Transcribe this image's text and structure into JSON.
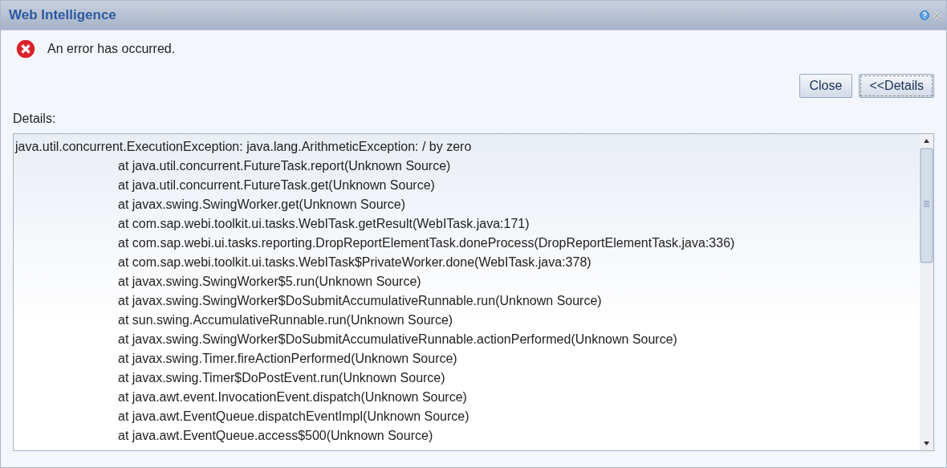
{
  "window": {
    "title": "Web Intelligence"
  },
  "message": "An error has occurred.",
  "buttons": [
    {
      "label": "Close",
      "focused": false
    },
    {
      "label": "<<Details",
      "focused": true
    }
  ],
  "details": {
    "label": "Details:",
    "lines": [
      {
        "kind": "exception",
        "text": "java.util.concurrent.ExecutionException: java.lang.ArithmeticException: / by zero"
      },
      {
        "kind": "frame",
        "text": "at java.util.concurrent.FutureTask.report(Unknown Source)"
      },
      {
        "kind": "frame",
        "text": "at java.util.concurrent.FutureTask.get(Unknown Source)"
      },
      {
        "kind": "frame",
        "text": "at javax.swing.SwingWorker.get(Unknown Source)"
      },
      {
        "kind": "frame",
        "text": "at com.sap.webi.toolkit.ui.tasks.WebITask.getResult(WebITask.java:171)"
      },
      {
        "kind": "frame",
        "text": "at com.sap.webi.ui.tasks.reporting.DropReportElementTask.doneProcess(DropReportElementTask.java:336)"
      },
      {
        "kind": "frame",
        "text": "at com.sap.webi.toolkit.ui.tasks.WebITask$PrivateWorker.done(WebITask.java:378)"
      },
      {
        "kind": "frame",
        "text": "at javax.swing.SwingWorker$5.run(Unknown Source)"
      },
      {
        "kind": "frame",
        "text": "at javax.swing.SwingWorker$DoSubmitAccumulativeRunnable.run(Unknown Source)"
      },
      {
        "kind": "frame",
        "text": "at sun.swing.AccumulativeRunnable.run(Unknown Source)"
      },
      {
        "kind": "frame",
        "text": "at javax.swing.SwingWorker$DoSubmitAccumulativeRunnable.actionPerformed(Unknown Source)"
      },
      {
        "kind": "frame",
        "text": "at javax.swing.Timer.fireActionPerformed(Unknown Source)"
      },
      {
        "kind": "frame",
        "text": "at javax.swing.Timer$DoPostEvent.run(Unknown Source)"
      },
      {
        "kind": "frame",
        "text": "at java.awt.event.InvocationEvent.dispatch(Unknown Source)"
      },
      {
        "kind": "frame",
        "text": "at java.awt.EventQueue.dispatchEventImpl(Unknown Source)"
      },
      {
        "kind": "frame",
        "text": "at java.awt.EventQueue.access$500(Unknown Source)"
      }
    ]
  }
}
